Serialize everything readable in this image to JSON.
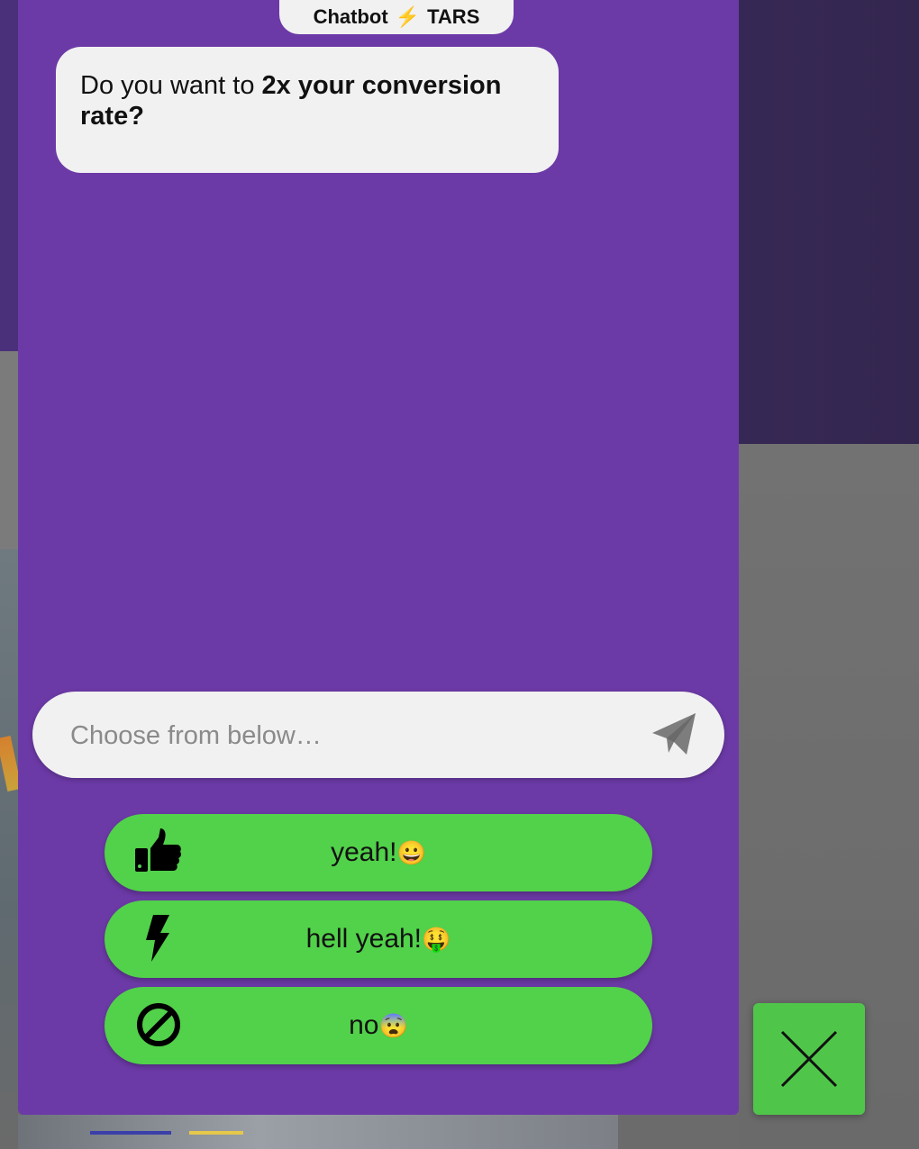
{
  "header": {
    "title_left": "Chatbot",
    "bolt_glyph": "⚡",
    "title_right": "TARS"
  },
  "bubble": {
    "text_plain": "Do you want to ",
    "text_bold": "2x your conversion rate?"
  },
  "input": {
    "placeholder": "Choose from below…",
    "value": ""
  },
  "options": [
    {
      "label": "yeah!",
      "emoji": "😀",
      "icon": "thumbs-up-icon"
    },
    {
      "label": "hell yeah!",
      "emoji": "🤑",
      "icon": "lightning-bolt-icon"
    },
    {
      "label": "no",
      "emoji": "😨",
      "icon": "prohibited-icon"
    }
  ],
  "colors": {
    "widget_bg": "#6c3aa7",
    "option_bg": "#52d14a",
    "close_bg": "#4fc64a",
    "bubble_bg": "#f1f1f1"
  }
}
